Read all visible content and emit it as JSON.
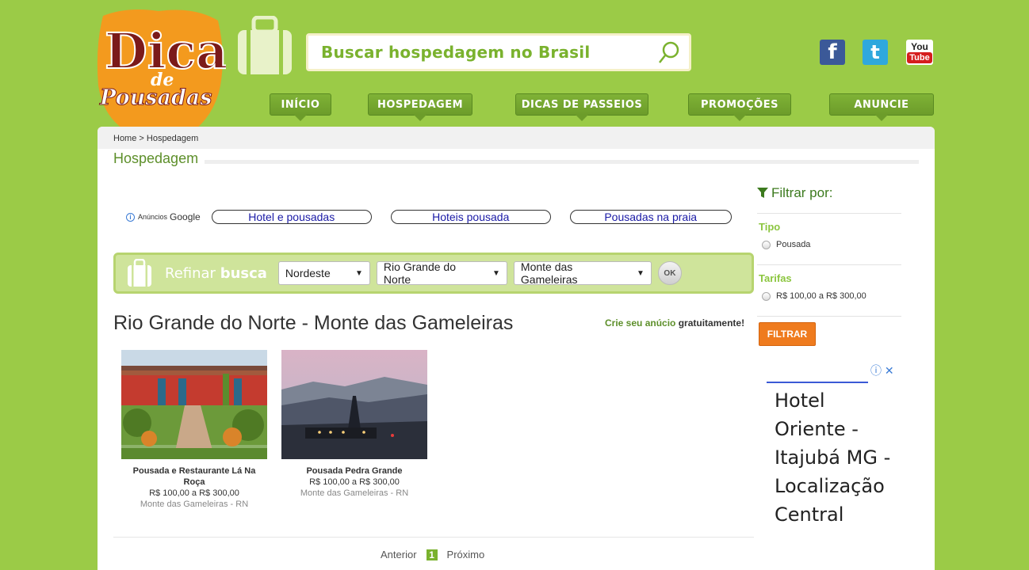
{
  "brand": {
    "logo_line1": "Dicas",
    "logo_line2": "de",
    "logo_line3": "Pousadas",
    "colors": {
      "background": "#9bcb47",
      "accent": "#7ab22e",
      "logo_orange": "#f39a1e",
      "logo_red": "#7b1a1a"
    }
  },
  "search": {
    "placeholder": "Buscar hospedagem no Brasil",
    "icon": "search-icon"
  },
  "social": [
    {
      "name": "facebook",
      "glyph": "f"
    },
    {
      "name": "twitter",
      "glyph": "t"
    },
    {
      "name": "youtube",
      "line1": "You",
      "line2": "Tube"
    }
  ],
  "nav": [
    {
      "label": "INÍCIO"
    },
    {
      "label": "HOSPEDAGEM"
    },
    {
      "label": "DICAS DE PASSEIOS"
    },
    {
      "label": "PROMOÇÕES"
    },
    {
      "label": "ANUNCIE"
    }
  ],
  "breadcrumb": "Home > Hospedagem",
  "section_title": "Hospedagem",
  "ads": {
    "label_small": "Anúncios",
    "label_brand": "Google",
    "links": [
      "Hotel e pousadas",
      "Hoteis pousada",
      "Pousadas na praia"
    ]
  },
  "refine": {
    "label_light": "Refinar",
    "label_bold": "busca",
    "selects": [
      "Nordeste",
      "Rio Grande do Norte",
      "Monte das Gameleiras"
    ],
    "ok": "OK"
  },
  "results_title": "Rio Grande do Norte - Monte das Gameleiras",
  "create_ad": {
    "link": "Crie seu anúcio",
    "rest": "gratuitamente!"
  },
  "listings": [
    {
      "name": "Pousada e Restaurante Lá Na Roça",
      "price": "R$ 100,00 a R$ 300,00",
      "location": "Monte das Gameleiras - RN"
    },
    {
      "name": "Pousada Pedra Grande",
      "price": "R$ 100,00 a R$ 300,00",
      "location": "Monte das Gameleiras - RN"
    }
  ],
  "pager": {
    "prev": "Anterior",
    "current": "1",
    "next": "Próximo"
  },
  "filter": {
    "heading": "Filtrar por:",
    "tipo_label": "Tipo",
    "tipo_option": "Pousada",
    "tarifas_label": "Tarifas",
    "tarifas_option": "R$ 100,00 a R$ 300,00",
    "button": "FILTRAR"
  },
  "side_ad": {
    "controls": "ⓘ ✕",
    "text": "Hotel Oriente - Itajubá MG - Localização Central"
  }
}
